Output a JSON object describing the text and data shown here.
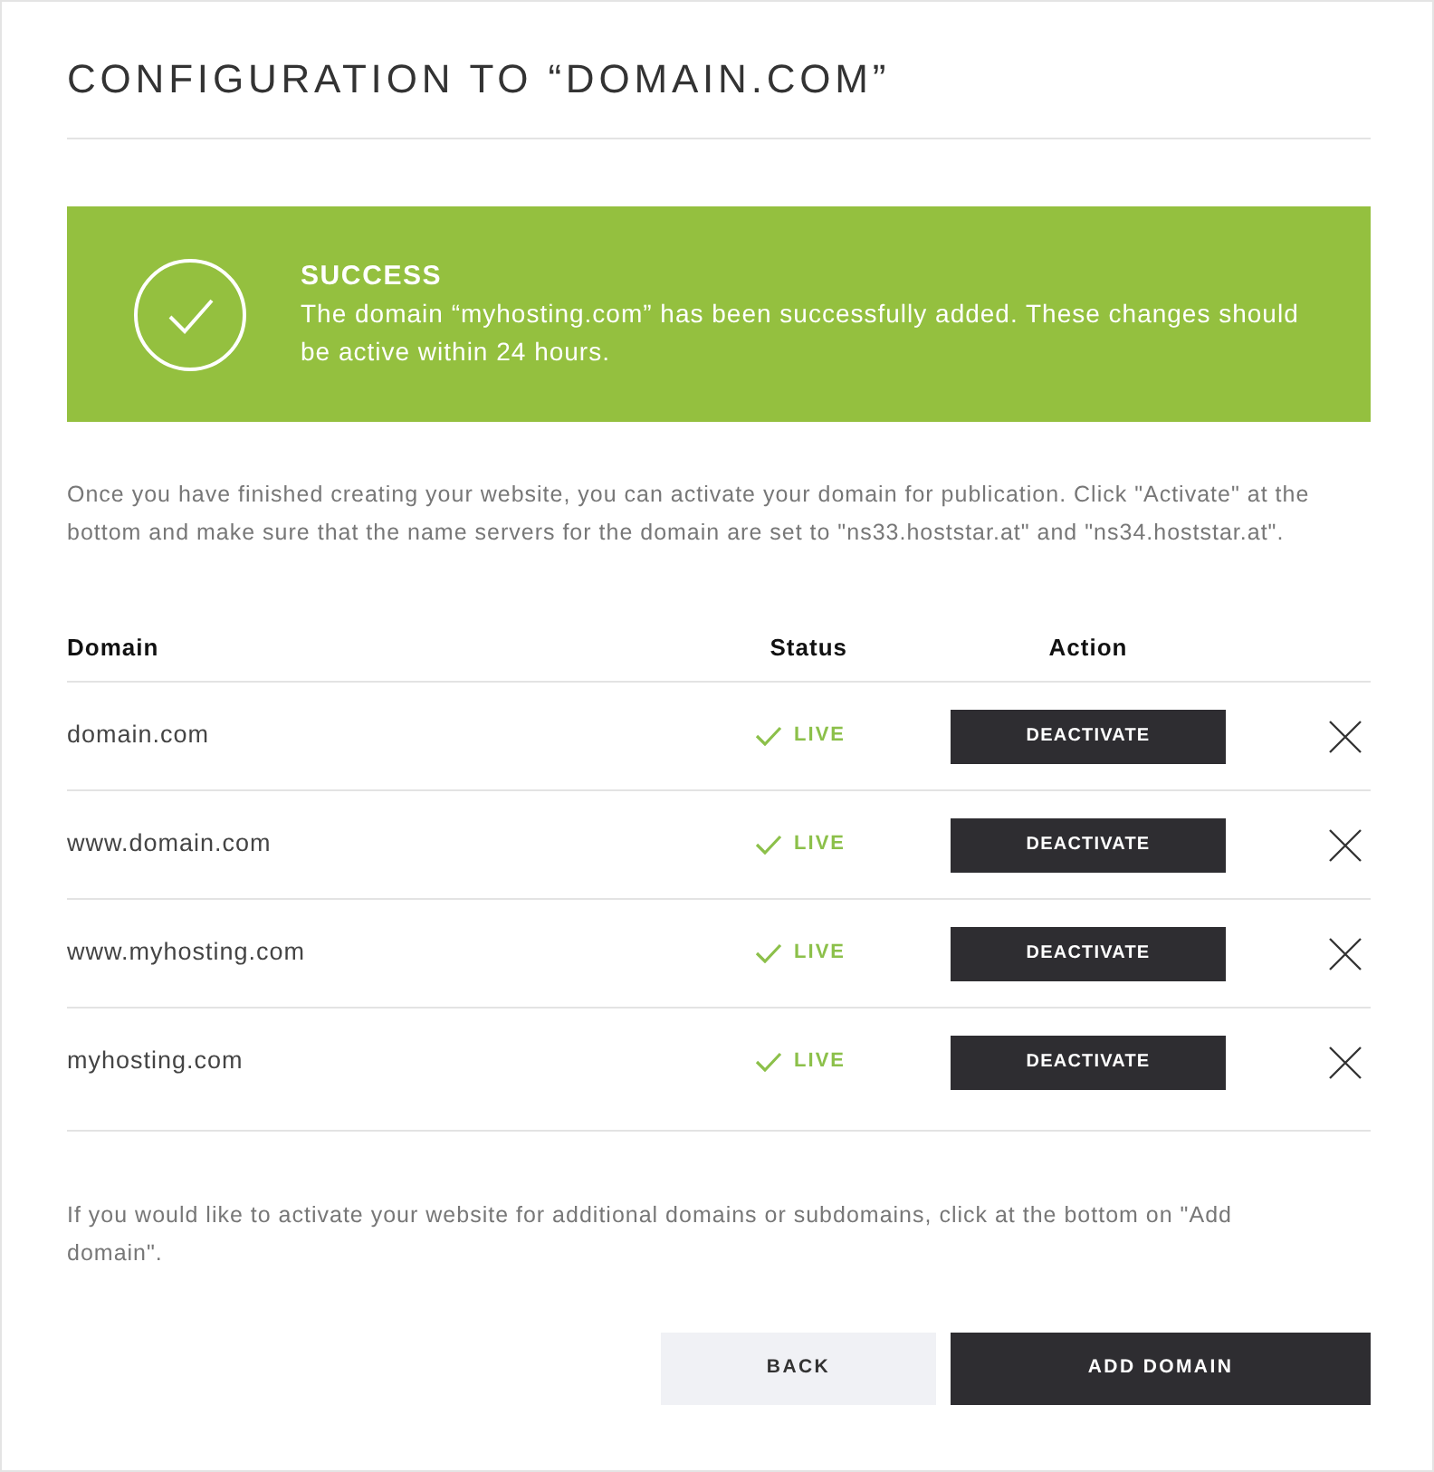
{
  "page": {
    "title": "CONFIGURATION TO “DOMAIN.COM”"
  },
  "alert": {
    "kind": "success",
    "title": "SUCCESS",
    "message": "The domain “myhosting.com” has been successfully added. These changes should be active within 24 hours."
  },
  "intro": "Once you have finished creating your website, you can activate your domain for publication. Click \"Activate\" at the bottom and make sure that the name servers for the domain are set to \"ns33.hoststar.at\" and \"ns34.hoststar.at\".",
  "table": {
    "columns": [
      "Domain",
      "Status",
      "Action"
    ],
    "rows": [
      {
        "domain": "domain.com",
        "status": "LIVE",
        "action": "DEACTIVATE"
      },
      {
        "domain": "www.domain.com",
        "status": "LIVE",
        "action": "DEACTIVATE"
      },
      {
        "domain": "www.myhosting.com",
        "status": "LIVE",
        "action": "DEACTIVATE"
      },
      {
        "domain": "myhosting.com",
        "status": "LIVE",
        "action": "DEACTIVATE"
      }
    ]
  },
  "note": "If you would like to activate your website for additional domains or subdomains, click at the bottom on \"Add domain\".",
  "buttons": [
    {
      "label": "BACK",
      "kind": "secondary"
    },
    {
      "label": "ADD DOMAIN",
      "kind": "primary"
    }
  ]
}
